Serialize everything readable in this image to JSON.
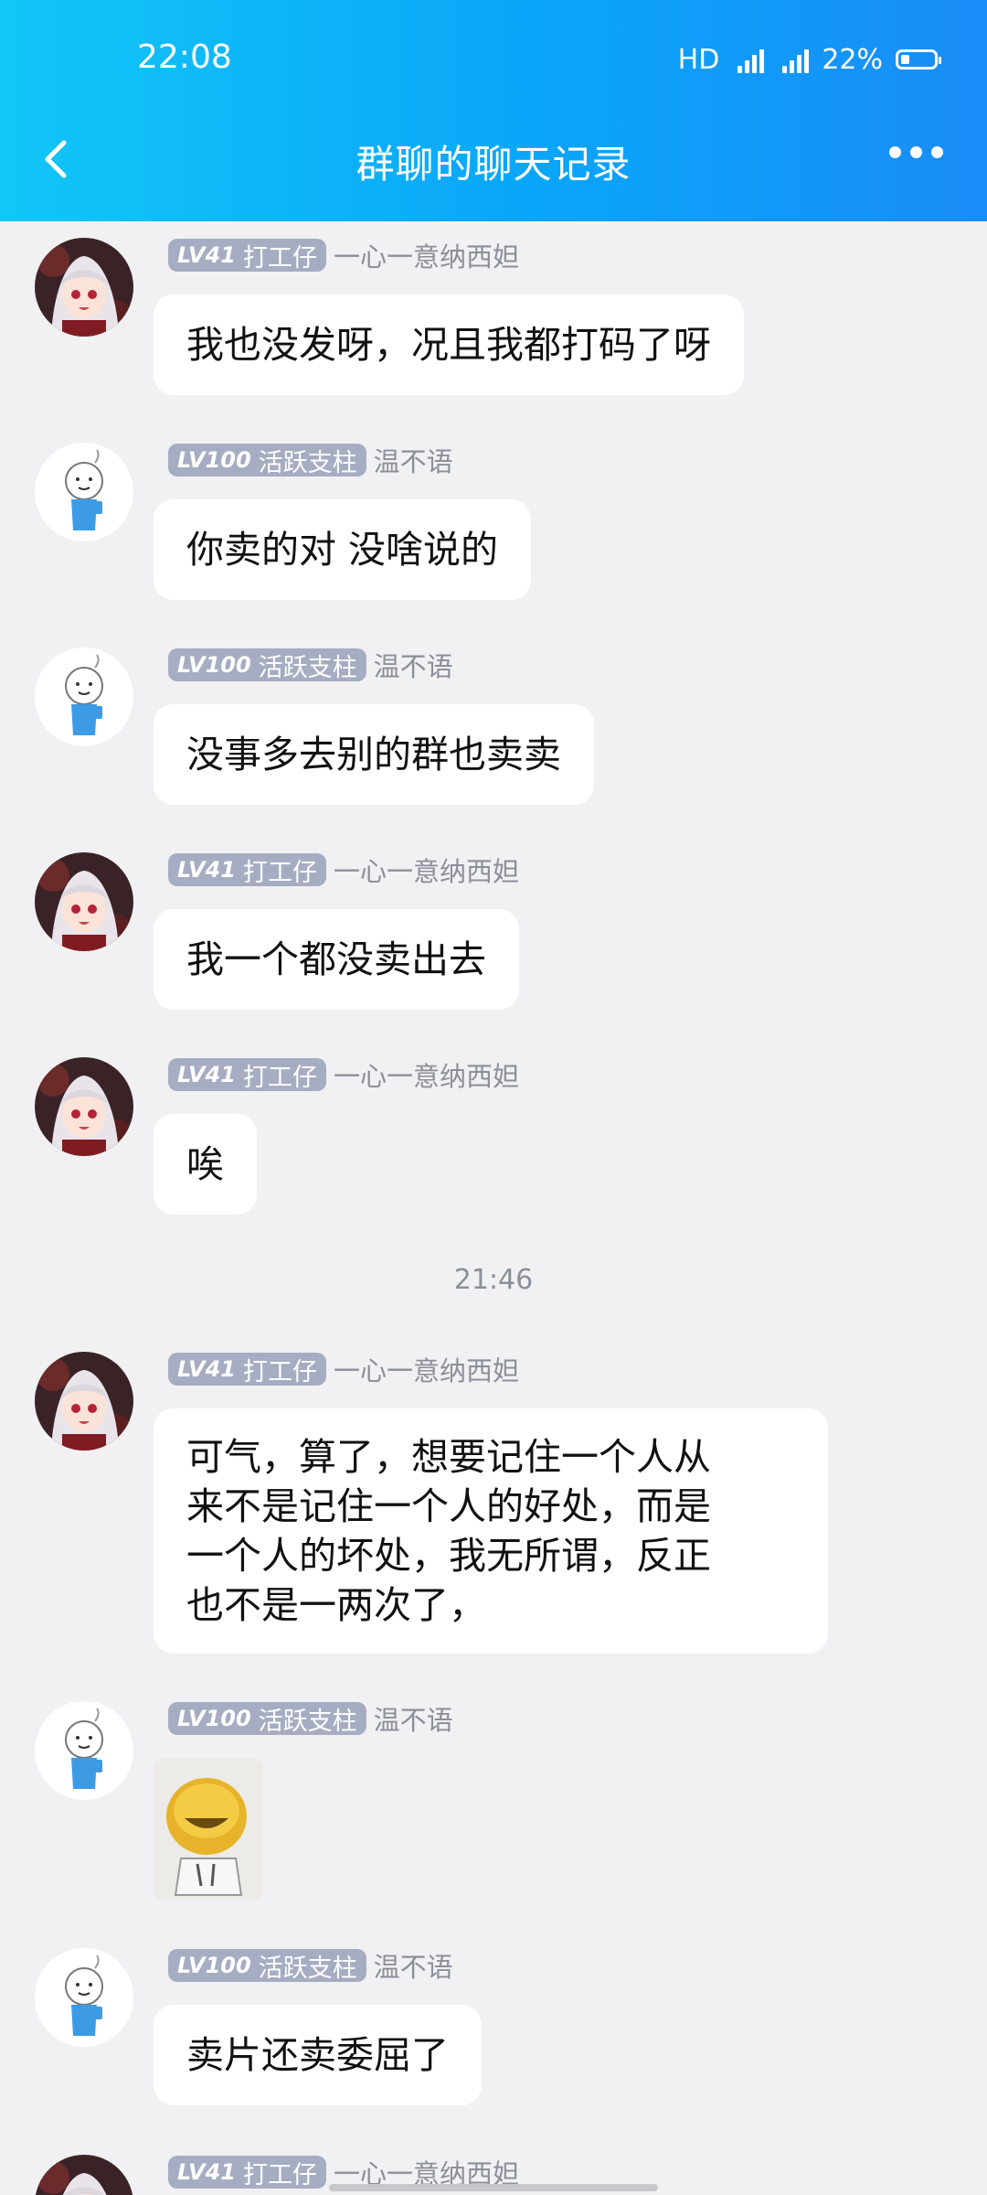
{
  "status_bar": {
    "time": "22:08",
    "hd_label": "HD",
    "net1": "4G",
    "net2": "4G+",
    "battery": "22%",
    "battery_level": 0.22
  },
  "header": {
    "title": "群聊的聊天记录",
    "back_icon": "chevron-left-icon",
    "more_icon": "more-horizontal-icon"
  },
  "users": {
    "a": {
      "level": "LV41",
      "title": "打工仔",
      "name": "一心一意纳西妲",
      "avatar": "anime-girl-avatar"
    },
    "b": {
      "level": "LV100",
      "title": "活跃支柱",
      "name": "温不语",
      "avatar": "cartoon-person-avatar"
    }
  },
  "messages": [
    {
      "user": "a",
      "text": "我也没发呀，况且我都打码了呀"
    },
    {
      "user": "b",
      "text": "你卖的对 没啥说的"
    },
    {
      "user": "b",
      "text": "没事多去别的群也卖卖"
    },
    {
      "user": "a",
      "text": "我一个都没卖出去"
    },
    {
      "user": "a",
      "text": "唉"
    },
    {
      "user": "a",
      "text": "可气，算了，想要记住一个人从来不是记住一个人的好处，而是一个人的坏处，我无所谓，反正也不是一两次了，",
      "lines": [
        "可气，算了，想要记住一个人从",
        "来不是记住一个人的好处，而是",
        "一个人的坏处，我无所谓，反正",
        "也不是一两次了，"
      ]
    },
    {
      "user": "b",
      "sticker": "yellow-smiley-sticker"
    },
    {
      "user": "b",
      "text": "卖片还卖委屈了"
    },
    {
      "user": "a"
    }
  ],
  "time_separator": "21:46"
}
